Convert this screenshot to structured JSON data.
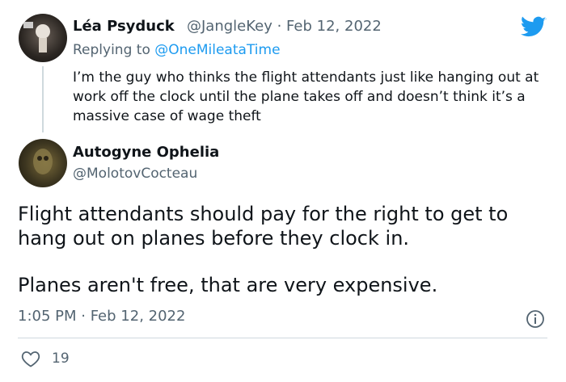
{
  "reply": {
    "author_name": "Léa Psyduck",
    "author_meta": "@JangleKey · Feb 12, 2022",
    "replying_prefix": "Replying to ",
    "replying_handle": "@OneMileataTime",
    "text": "I’m the guy who thinks the flight attendants just like hanging out at work off the clock until the plane takes off and doesn’t think it’s a massive case of wage theft"
  },
  "main": {
    "author_name": "Autogyne Ophelia",
    "author_handle": "@MolotovCocteau",
    "text_para_1": "Flight attendants should pay for the right to get to hang out on planes before they clock in.",
    "text_para_2": "Planes aren't free, that are very expensive.",
    "timestamp": "1:05 PM · Feb 12, 2022",
    "like_count": "19"
  },
  "icons": {
    "brand": "twitter-bird-icon",
    "info": "info-icon",
    "like": "heart-icon"
  },
  "colors": {
    "brand_blue": "#1d9bf0",
    "text_primary": "#0f1419",
    "text_secondary": "#536471",
    "divider": "#cfd9de"
  }
}
